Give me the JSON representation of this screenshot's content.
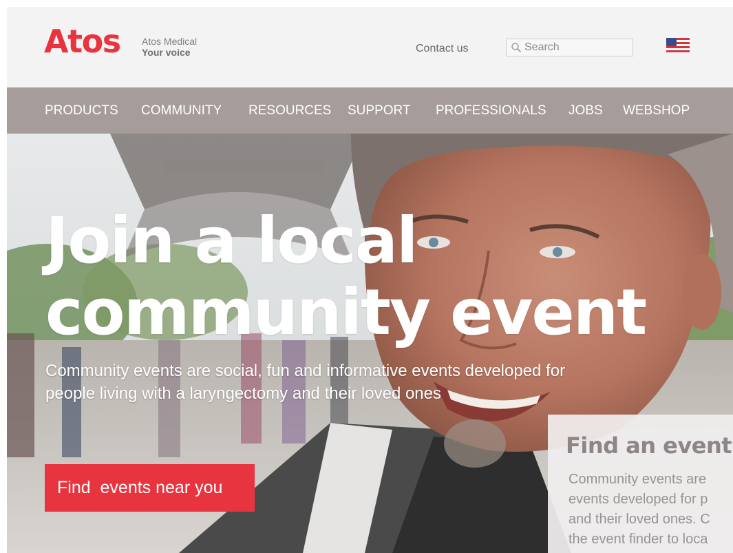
{
  "brand": {
    "logo_text": "Atos",
    "tagline_line1": "Atos Medical",
    "tagline_line2": "Your voice",
    "brand_color": "#e8343f"
  },
  "header": {
    "contact_label": "Contact us",
    "search_placeholder": "Search",
    "search_icon": "search-icon",
    "flag_icon": "us-flag-icon"
  },
  "nav": {
    "background_color": "#a69d9a",
    "items": [
      {
        "label": "PRODUCTS"
      },
      {
        "label": "COMMUNITY"
      },
      {
        "label": "RESOURCES"
      },
      {
        "label": "SUPPORT"
      },
      {
        "label": "PROFESSIONALS"
      },
      {
        "label": "JOBS"
      },
      {
        "label": "WEBSHOP"
      }
    ]
  },
  "hero": {
    "title_line1": "Join a local",
    "title_line2": "community event",
    "description": "Community events are social, fun and informative events developed for people living with a laryngectomy and their loved ones",
    "cta_label": "Find  events near you",
    "cta_color": "#e8343f"
  },
  "event_card": {
    "title": "Find an event i",
    "body_lines": [
      "Community events are",
      "events developed for p",
      "and their loved ones. C",
      "the event finder to loca"
    ]
  }
}
